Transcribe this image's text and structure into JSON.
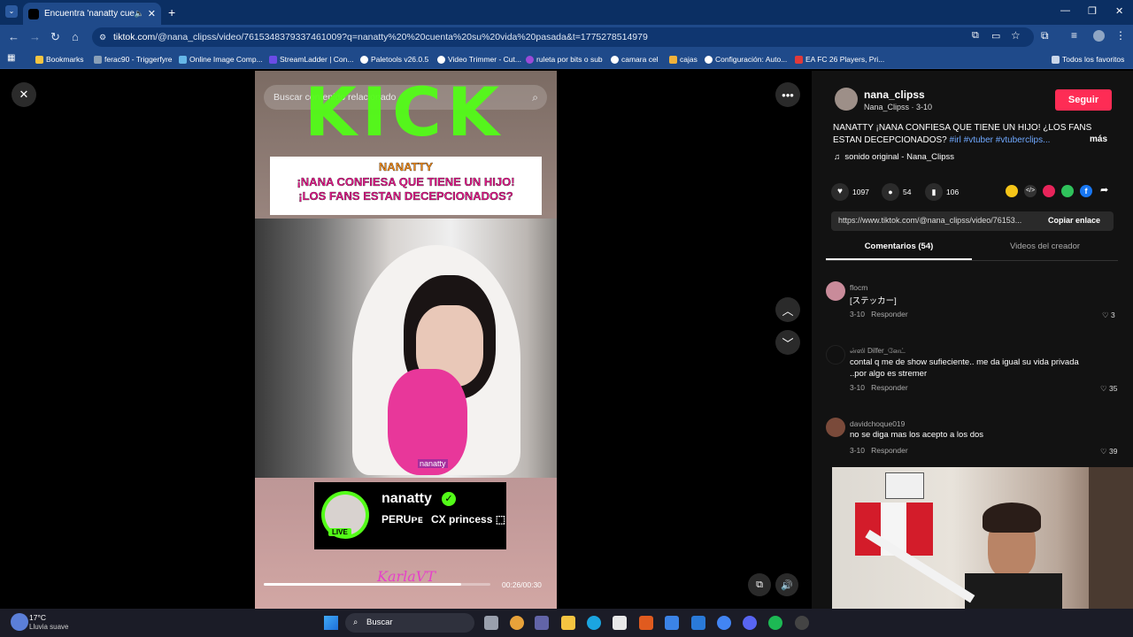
{
  "browser": {
    "tab_title": "Encuentra 'nanatty cuenta",
    "url_host": "tiktok.com",
    "url_path": "/@nana_clipss/video/7615348379337461009?q=nanatty%20%20cuenta%20su%20vida%20pasada&t=1775278514979",
    "bookmarks": [
      {
        "label": "Bookmarks",
        "color": "#f5c542"
      },
      {
        "label": "ferac90 - Triggerfyre",
        "color": "#8aa0b8"
      },
      {
        "label": "Online Image Comp...",
        "color": "#66b7e8"
      },
      {
        "label": "StreamLadder | Con...",
        "color": "#6b4ce6"
      },
      {
        "label": "Paletools v26.0.5",
        "color": "#ffffff"
      },
      {
        "label": "Video Trimmer - Cut...",
        "color": "#ffffff"
      },
      {
        "label": "ruleta por bits o sub",
        "color": "#9b4bd8"
      },
      {
        "label": "camara cel",
        "color": "#ffffff"
      },
      {
        "label": "cajas",
        "color": "#f0b23b"
      },
      {
        "label": "Configuración: Auto...",
        "color": "#ffffff"
      },
      {
        "label": "EA FC 26 Players, Pri...",
        "color": "#e03a3a"
      }
    ],
    "all_favorites": "Todos los favoritos"
  },
  "video": {
    "search_placeholder": "Buscar contenido relacionado",
    "kick_text": "KICK",
    "headline_name": "NANATTY",
    "headline_line1": "¡NANA CONFIESA QUE TIENE UN HIJO!",
    "headline_line2": "¡LOS FANS ESTAN DECEPCIONADOS?",
    "watermark": "nanatty",
    "card_name": "nanatty",
    "card_live": "LIVE",
    "card_country": "PERUᴘᴇ",
    "card_tag": "CX princess ⬚",
    "signature": "KarlaVT",
    "time": "00:26/00:30",
    "progress": 0.87
  },
  "panel": {
    "username": "nana_clipss",
    "display_name": "Nana_Clipss",
    "date": "3-10",
    "follow_label": "Seguir",
    "caption": "NANATTY ¡NANA CONFIESA QUE TIENE UN HIJO! ¿LOS FANS ESTAN DECEPCIONADOS?",
    "hashtags": "#irl #vtuber #vtuberclips...",
    "more": "más",
    "sound": "sonido original - Nana_Clipss",
    "likes": "1097",
    "comments_count": "54",
    "saves": "106",
    "link": "https://www.tiktok.com/@nana_clipss/video/76153...",
    "copy_label": "Copiar enlace",
    "tab_comments": "Comentarios (54)",
    "tab_videos": "Videos del creador",
    "reply_label": "Responder",
    "share_colors": [
      "#f5c518",
      "#333333",
      "#e8245a",
      "#2fc25b",
      "#1877f2"
    ]
  },
  "comments": [
    {
      "user": "flocm",
      "text": "[ステッカー]",
      "date": "3-10",
      "likes": "3",
      "avatar_color": "#c98b9a"
    },
    {
      "user": "ன்ஸி Dilfer_னேட்",
      "text": "contal q me de show sufieciente.. me da igual su vida privada ..por algo es stremer",
      "date": "3-10",
      "likes": "35",
      "avatar_color": "#111111"
    },
    {
      "user": "davidchoque019",
      "text": "no se diga mas los acepto a los dos",
      "date": "3-10",
      "likes": "39",
      "avatar_color": "#7a4a3a"
    }
  ],
  "weather": {
    "temp": "17°C",
    "desc": "Lluvia suave"
  },
  "taskbar": {
    "search": "Buscar"
  }
}
